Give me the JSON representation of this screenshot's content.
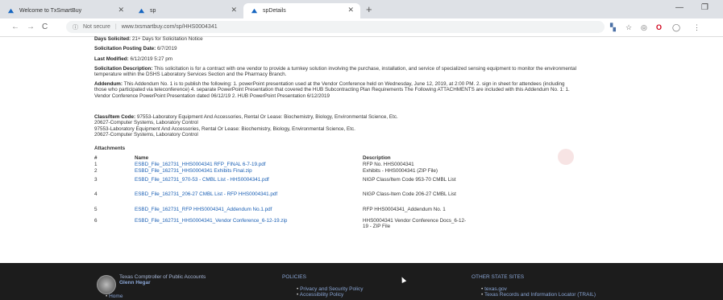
{
  "browser": {
    "tabs": [
      {
        "title": "Welcome to TxSmartBuy",
        "active": false
      },
      {
        "title": "sp",
        "active": false
      },
      {
        "title": "spDetails",
        "active": true
      }
    ],
    "new_tab_symbol": "+",
    "window_controls": [
      "—",
      "❐"
    ],
    "security_label": "Not secure",
    "url": "www.txsmartbuy.com/sp/HHS0004341"
  },
  "solicitation": {
    "days_solicited_label": "Days Solicited:",
    "days_solicited": "21+ Days for Solicitation Notice",
    "posting_date_label": "Solicitation Posting Date:",
    "posting_date": "6/7/2019",
    "last_modified_label": "Last Modified:",
    "last_modified": "6/12/2019 5:27 pm",
    "description_label": "Solicitation Description:",
    "description": "This solicitation is for a contract with one vendor to provide a turnkey solution involving the purchase, installation, and service of specialized sensing equipment to monitor the environmental temperature within the DSHS Laboratory Services Section and the Pharmacy Branch.",
    "addendum_label": "Addendum:",
    "addendum": "This Addendum No. 1 is to publish the following: 1. powerPoint presentation used at the Vendor Conference held on Wednesday, June 12, 2019, at 2:00 PM. 2. sign in sheet for attendees (including those who participated via teleconference) 4. separate PowerPoint Presentation that covered the HUB Subcontracting Plan Requirements The Following ATTACHMENTS are included with this Addendum No. 1: 1. Vendor Conference PowerPoint Presentation dated 06/12/19 2. HUB PowerPoint Presentation 6/12/2019",
    "class_item_label": "Class/Item Code:",
    "class_item_lines": [
      "97553-Laboratory Equipment And Accessories, Rental Or Lease: Biochemistry, Biology, Environmental Science, Etc.",
      "20627-Computer Systems, Laboratory Control",
      "97553-Laboratory Equipment And Accessories, Rental Or Lease: Biochemistry, Biology, Environmental Science, Etc.",
      "20627-Computer Systems, Laboratory Control"
    ]
  },
  "attachments": {
    "heading": "Attachments",
    "columns": [
      "#",
      "Name",
      "Description"
    ],
    "rows": [
      {
        "num": "1",
        "name": "ESBD_File_162731_HHS0004341 RFP_FINAL 6-7-19.pdf",
        "desc": "RFP No. HHS0004341"
      },
      {
        "num": "2",
        "name": "ESBD_File_162731_HHS0004341 Exhibits Final.zip",
        "desc": "Exhibits - HHS0004341 (ZIP File)"
      },
      {
        "num": "3",
        "name": "ESBD_File_162731_970-53 - CMBL List - HHS0004341.pdf",
        "desc": "NIGP Class/Item Code 953-70 CMBL List"
      },
      {
        "num": "4",
        "name": "ESBD_File_162731_206-27 CMBL List - RFP HHS0004341.pdf",
        "desc": "NIGP Class-Item Code 206-27 CMBL List"
      },
      {
        "num": "5",
        "name": "ESBD_File_162731_RFP HHS0004341_Addendum No.1.pdf",
        "desc": "RFP HHS0004341_Addendum No. 1"
      },
      {
        "num": "6",
        "name": "ESBD_File_162731_HHS0004341_Vendor Conference_6-12-19.zip",
        "desc": "HHS0004341 Vendor Conference Docs_6-12-19 - ZIP File"
      }
    ]
  },
  "footer": {
    "org_name": "Texas Comptroller of Public Accounts",
    "person": "Glenn Hegar",
    "home_link": "Home",
    "policies_title": "POLICIES",
    "policies_items": [
      "Privacy and Security Policy",
      "Accessibility Policy"
    ],
    "other_sites_title": "OTHER STATE SITES",
    "other_sites_items": [
      "texas.gov",
      "Texas Records and Information Locator (TRAIL)"
    ]
  }
}
